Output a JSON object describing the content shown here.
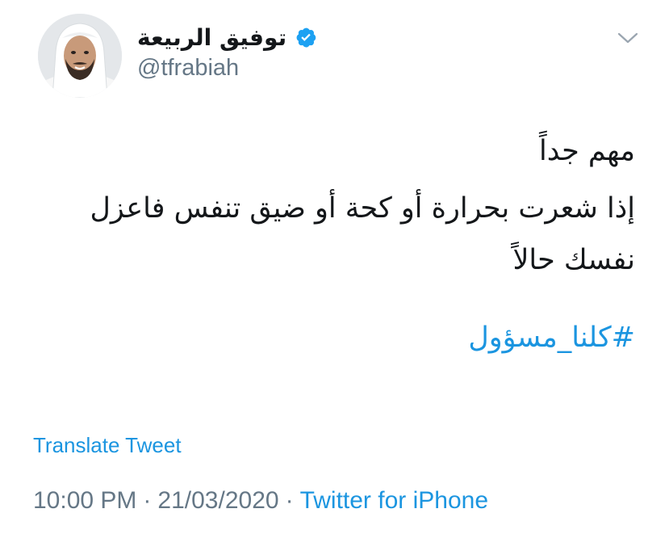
{
  "author": {
    "display_name": "توفيق الربيعة",
    "handle": "@tfrabiah",
    "verified_icon": "verified-badge-icon",
    "avatar_icon": "avatar"
  },
  "menu": {
    "icon": "chevron-down-icon"
  },
  "tweet": {
    "line1": "مهم جداً",
    "line2": "إذا شعرت بحرارة أو كحة أو ضيق تنفس فاعزل نفسك حالاً",
    "hashtag": "#كلنا_مسؤول"
  },
  "translate_label": "Translate Tweet",
  "meta": {
    "time": "10:00 PM",
    "separator": "·",
    "date": "21/03/2020",
    "source": "Twitter for iPhone"
  },
  "colors": {
    "link": "#1b95e0",
    "secondary": "#657786",
    "text": "#14171a"
  }
}
